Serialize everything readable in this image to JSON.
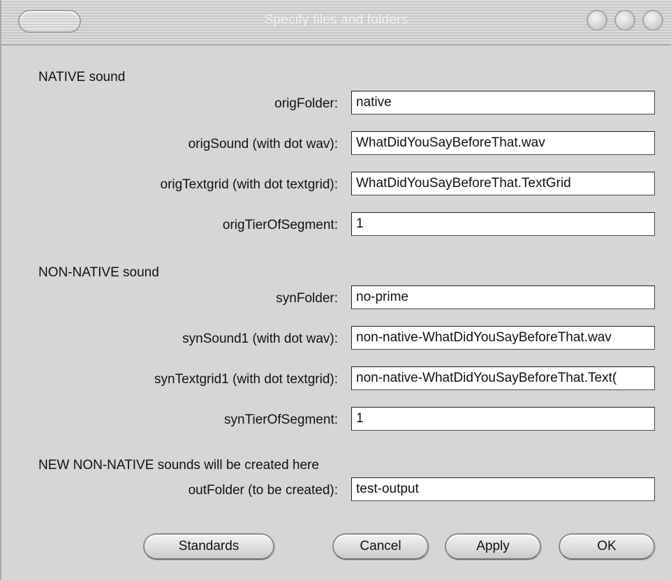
{
  "window": {
    "title": "Specify files and folders"
  },
  "sections": {
    "native": "NATIVE sound",
    "non_native": "NON-NATIVE sound",
    "new_non_native": "NEW NON-NATIVE sounds will be created here"
  },
  "fields": {
    "origFolder": {
      "label": "origFolder:",
      "value": "native"
    },
    "origSound": {
      "label": "origSound (with dot wav):",
      "value": "WhatDidYouSayBeforeThat.wav"
    },
    "origTextgrid": {
      "label": "origTextgrid (with dot textgrid):",
      "value": "WhatDidYouSayBeforeThat.TextGrid"
    },
    "origTierOfSegment": {
      "label": "origTierOfSegment:",
      "value": "1"
    },
    "synFolder": {
      "label": "synFolder:",
      "value": "no-prime"
    },
    "synSound1": {
      "label": "synSound1 (with dot wav):",
      "value": "non-native-WhatDidYouSayBeforeThat.wav"
    },
    "synTextgrid1": {
      "label": "synTextgrid1 (with dot textgrid):",
      "value": "non-native-WhatDidYouSayBeforeThat.Text("
    },
    "synTierOfSegment": {
      "label": "synTierOfSegment:",
      "value": "1"
    },
    "outFolder": {
      "label": "outFolder (to be created):",
      "value": "test-output"
    }
  },
  "buttons": {
    "standards": "Standards",
    "cancel": "Cancel",
    "apply": "Apply",
    "ok": "OK"
  }
}
